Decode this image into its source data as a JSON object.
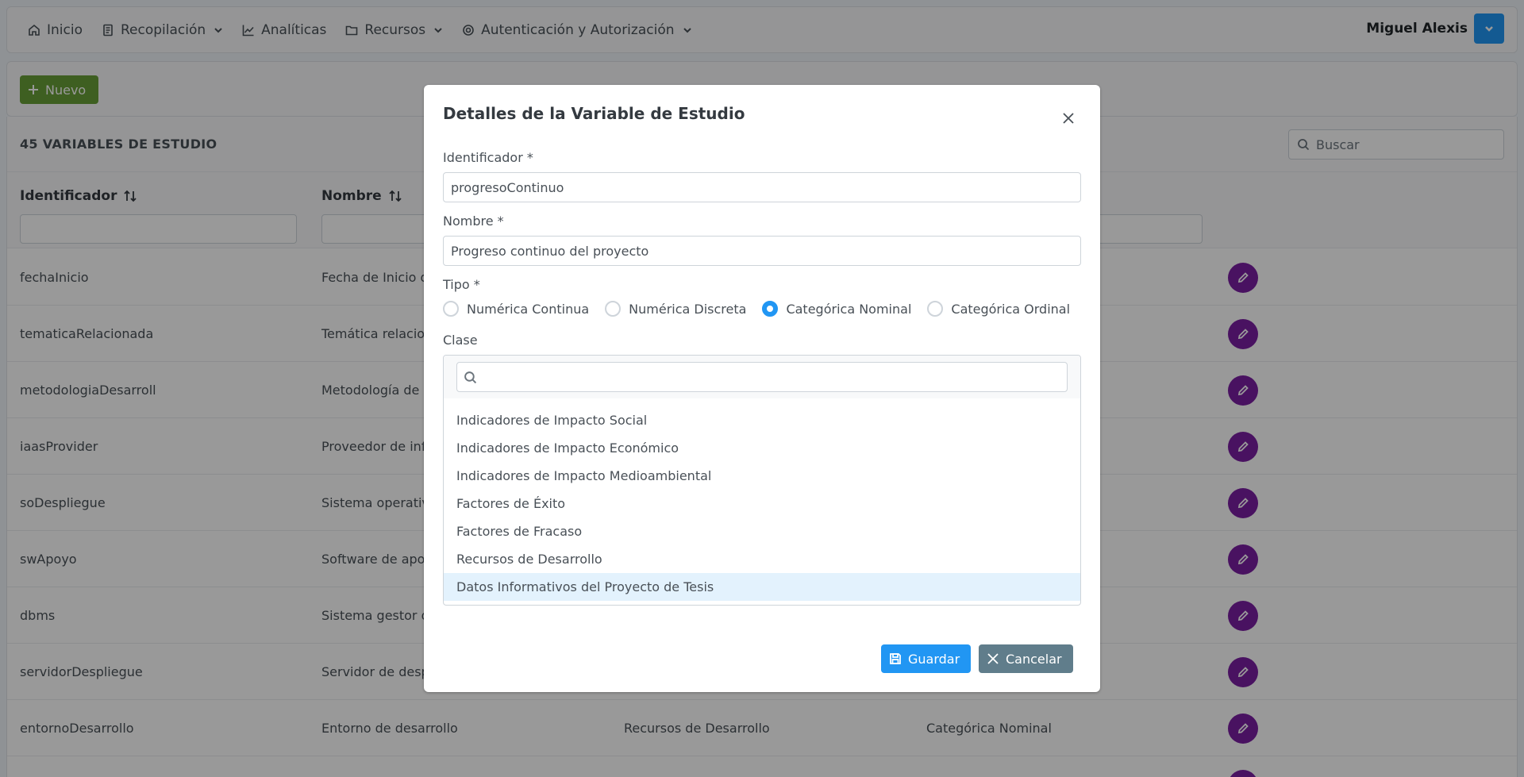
{
  "menubar": {
    "items": [
      {
        "label": "Inicio",
        "icon": "home-icon"
      },
      {
        "label": "Recopilación",
        "icon": "file-icon"
      },
      {
        "label": "Analíticas",
        "icon": "chart-line-icon"
      },
      {
        "label": "Recursos",
        "icon": "folder-icon"
      },
      {
        "label": "Autenticación y Autorización",
        "icon": "cog-icon"
      }
    ],
    "user": "Miguel Alexis"
  },
  "toolbar": {
    "new_label": "Nuevo"
  },
  "table": {
    "title": "45 VARIABLES DE ESTUDIO",
    "search_placeholder": "Buscar",
    "columns": [
      "Identificador",
      "Nombre"
    ],
    "rows": [
      {
        "id": "fechaInicio",
        "name": "Fecha de Inicio d",
        "clase": "",
        "tipo": ""
      },
      {
        "id": "tematicaRelacionada",
        "name": "Temática relacio",
        "clase": "",
        "tipo": ""
      },
      {
        "id": "metodologiaDesarroll",
        "name": "Metodología de",
        "clase": "",
        "tipo": ""
      },
      {
        "id": "iaasProvider",
        "name": "Proveedor de inf",
        "clase": "",
        "tipo": ""
      },
      {
        "id": "soDespliegue",
        "name": "Sistema operativ",
        "clase": "",
        "tipo": ""
      },
      {
        "id": "swApoyo",
        "name": "Software de apo",
        "clase": "",
        "tipo": ""
      },
      {
        "id": "dbms",
        "name": "Sistema gestor d",
        "clase": "",
        "tipo": ""
      },
      {
        "id": "servidorDespliegue",
        "name": "Servidor de desp",
        "clase": "",
        "tipo": ""
      },
      {
        "id": "entornoDesarrollo",
        "name": "Entorno de desarrollo",
        "clase": "Recursos de Desarrollo",
        "tipo": "Categórica Nominal"
      }
    ]
  },
  "dialog": {
    "title": "Detalles de la Variable de Estudio",
    "identificador_label": "Identificador *",
    "identificador_value": "progresoContinuo",
    "nombre_label": "Nombre *",
    "nombre_value": "Progreso continuo del proyecto",
    "tipo_label": "Tipo *",
    "tipo_options": [
      {
        "label": "Numérica Continua",
        "selected": false
      },
      {
        "label": "Numérica Discreta",
        "selected": false
      },
      {
        "label": "Categórica Nominal",
        "selected": true
      },
      {
        "label": "Categórica Ordinal",
        "selected": false
      }
    ],
    "clase_label": "Clase",
    "clase_filter_value": "",
    "clase_options": [
      "Indicadores de Impacto Social",
      "Indicadores de Impacto Económico",
      "Indicadores de Impacto Medioambiental",
      "Factores de Éxito",
      "Factores de Fracaso",
      "Recursos de Desarrollo",
      "Datos Informativos del Proyecto de Tesis"
    ],
    "clase_selected": "Datos Informativos del Proyecto de Tesis",
    "save_label": "Guardar",
    "cancel_label": "Cancelar"
  },
  "colors": {
    "primary": "#2196f3",
    "success": "#689f38",
    "help": "#7b1fa2",
    "secondary": "#607d8b"
  }
}
